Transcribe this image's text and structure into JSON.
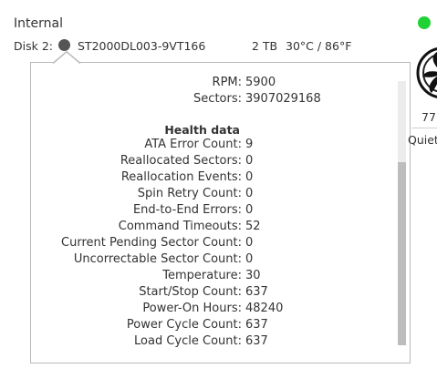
{
  "section": {
    "title": "Internal"
  },
  "disk": {
    "label": "Disk 2:",
    "model": "ST2000DL003-9VT166",
    "size": "2 TB",
    "temperature": "30°C / 86°F"
  },
  "details": {
    "rpm_label": "RPM:",
    "rpm": "5900",
    "sectors_label": "Sectors:",
    "sectors": "3907029168",
    "health_title": "Health data",
    "health": [
      {
        "label": "ATA Error Count:",
        "value": "9"
      },
      {
        "label": "Reallocated Sectors:",
        "value": "0"
      },
      {
        "label": "Reallocation Events:",
        "value": "0"
      },
      {
        "label": "Spin Retry Count:",
        "value": "0"
      },
      {
        "label": "End-to-End Errors:",
        "value": "0"
      },
      {
        "label": "Command Timeouts:",
        "value": "52"
      },
      {
        "label": "Current Pending Sector Count:",
        "value": "0"
      },
      {
        "label": "Uncorrectable Sector Count:",
        "value": "0"
      },
      {
        "label": "Temperature:",
        "value": "30"
      },
      {
        "label": "Start/Stop Count:",
        "value": "637"
      },
      {
        "label": "Power-On Hours:",
        "value": "48240"
      },
      {
        "label": "Power Cycle Count:",
        "value": "637"
      },
      {
        "label": "Load Cycle Count:",
        "value": "637"
      }
    ]
  },
  "fan": {
    "value_text": "77",
    "mode_text": "Quiet"
  },
  "colors": {
    "status_ok": "#1fd135",
    "popover_border": "#b9b9b9",
    "scroll_thumb": "#bdbdbd"
  },
  "icons": {
    "status": "status-dot-icon",
    "fan": "fan-icon",
    "disk_pointer": "disk-pointer-icon"
  }
}
